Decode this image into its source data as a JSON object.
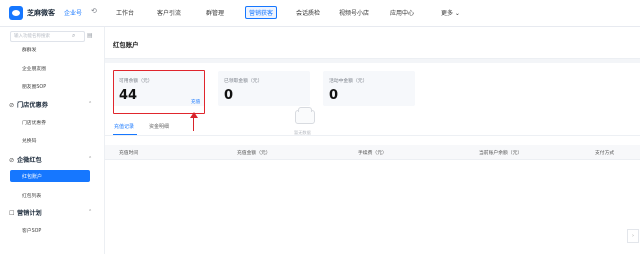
{
  "app": {
    "brand": "芝麻微客",
    "edition": "企业号"
  },
  "top_nav": [
    "工作台",
    "客户引流",
    "群管理",
    "营销获客",
    "会话质检",
    "视频号小店",
    "应用中心",
    "更多 ⌄"
  ],
  "sidebar": {
    "search_placeholder": "输入功能名称搜索",
    "items_top": [
      "群群发",
      "企业朋友圈",
      "朋友圈SOP"
    ],
    "group_store": "门店优惠券",
    "store_items": [
      "门店优惠券",
      "兑换码"
    ],
    "group_packet": "企微红包",
    "packet_items": [
      "红包账户",
      "红包列表"
    ],
    "group_marketing": "营销计划",
    "marketing_items": [
      "客户SOP"
    ]
  },
  "page": {
    "title": "红包账户"
  },
  "stats": [
    {
      "label": "可用余额（元）",
      "value": "44",
      "link": "充值"
    },
    {
      "label": "已领取金额（元）",
      "value": "0"
    },
    {
      "label": "活动中金额（元）",
      "value": "0"
    }
  ],
  "tabs": [
    "充值记录",
    "资金明细"
  ],
  "table": {
    "columns": [
      "充值时间",
      "充值金额（元）",
      "手续费（元）",
      "当前账户余额（元）",
      "支付方式"
    ],
    "empty_text": "暂无数据"
  }
}
